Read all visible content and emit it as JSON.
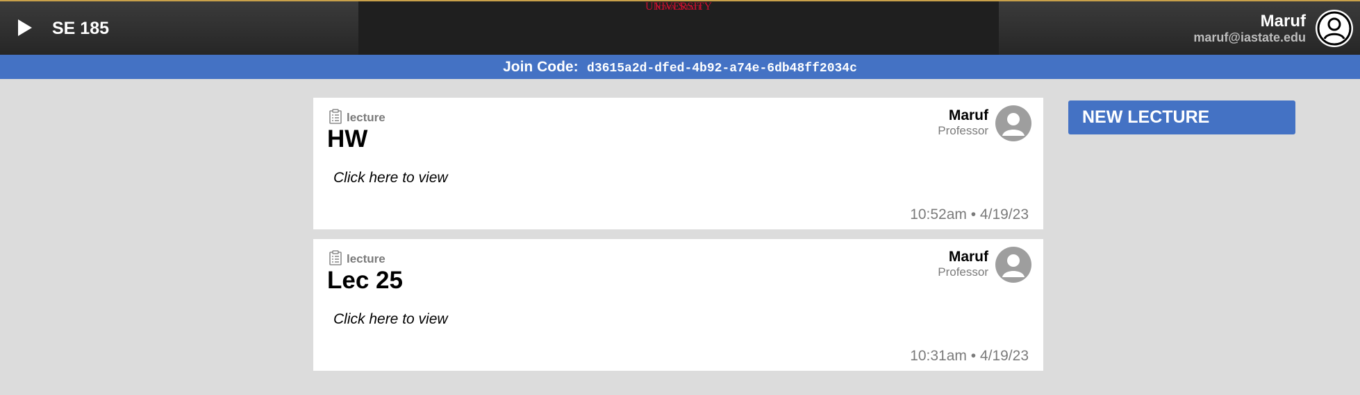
{
  "header": {
    "course_title": "SE 185",
    "logo_line1": "Iowa State",
    "logo_line2": "University",
    "user_name": "Maruf",
    "user_email": "maruf@iastate.edu"
  },
  "join": {
    "label": "Join Code:",
    "code": "d3615a2d-dfed-4b92-a74e-6db48ff2034c"
  },
  "posts": [
    {
      "type": "lecture",
      "title": "HW",
      "cta": "Click here to view",
      "author": "Maruf",
      "role": "Professor",
      "time": "10:52am • 4/19/23"
    },
    {
      "type": "lecture",
      "title": "Lec 25",
      "cta": "Click here to view",
      "author": "Maruf",
      "role": "Professor",
      "time": "10:31am • 4/19/23"
    }
  ],
  "actions": {
    "new_lecture_label": "NEW LECTURE"
  },
  "colors": {
    "accent_blue": "#4472c4",
    "brand_red": "#c8102e",
    "header_dark": "#262626",
    "page_bg": "#dcdcdc"
  }
}
